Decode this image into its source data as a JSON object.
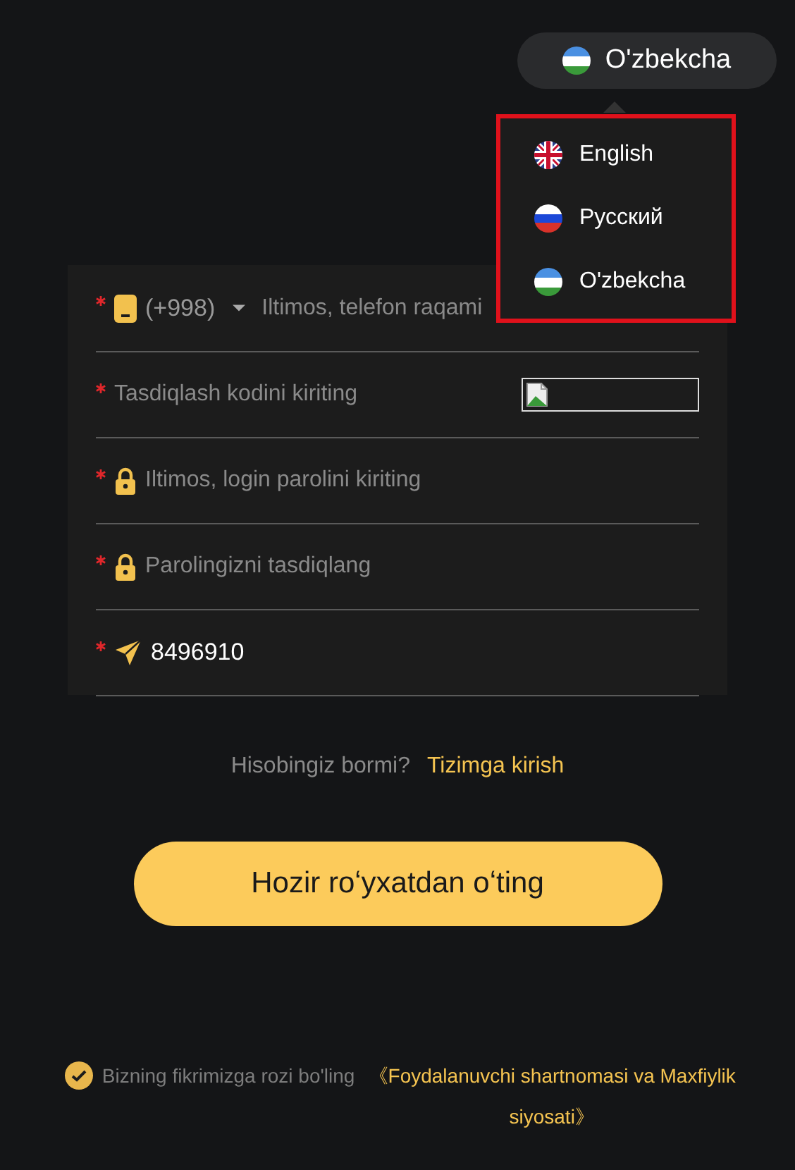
{
  "language_button": {
    "label": "O'zbekcha",
    "kind": "uz"
  },
  "language_menu": {
    "open": true,
    "items": [
      {
        "label": "English",
        "kind": "uk"
      },
      {
        "label": "Русский",
        "kind": "ru"
      },
      {
        "label": "O'zbekcha",
        "kind": "uz"
      }
    ]
  },
  "form": {
    "fields": [
      {
        "kind": "phone",
        "required": true,
        "prefix": "(+998)",
        "placeholder": "Iltimos, telefon raqami"
      },
      {
        "kind": "captcha",
        "required": true,
        "placeholder": "Tasdiqlash kodini kiriting"
      },
      {
        "kind": "password",
        "required": true,
        "placeholder": "Iltimos, login parolini kiriting"
      },
      {
        "kind": "password",
        "required": true,
        "placeholder": "Parolingizni tasdiqlang"
      },
      {
        "kind": "invite",
        "required": true,
        "value": "8496910"
      }
    ]
  },
  "login_prompt": {
    "text": "Hisobingiz bormi?",
    "link": "Tizimga kirish"
  },
  "register_button": "Hozir roʻyxatdan oʻting",
  "agreement": {
    "checked": true,
    "text": "Bizning fikrimizga rozi bo'ling",
    "link": "《Foydalanuvchi shartnomasi va Maxfiylik siyosati》"
  }
}
